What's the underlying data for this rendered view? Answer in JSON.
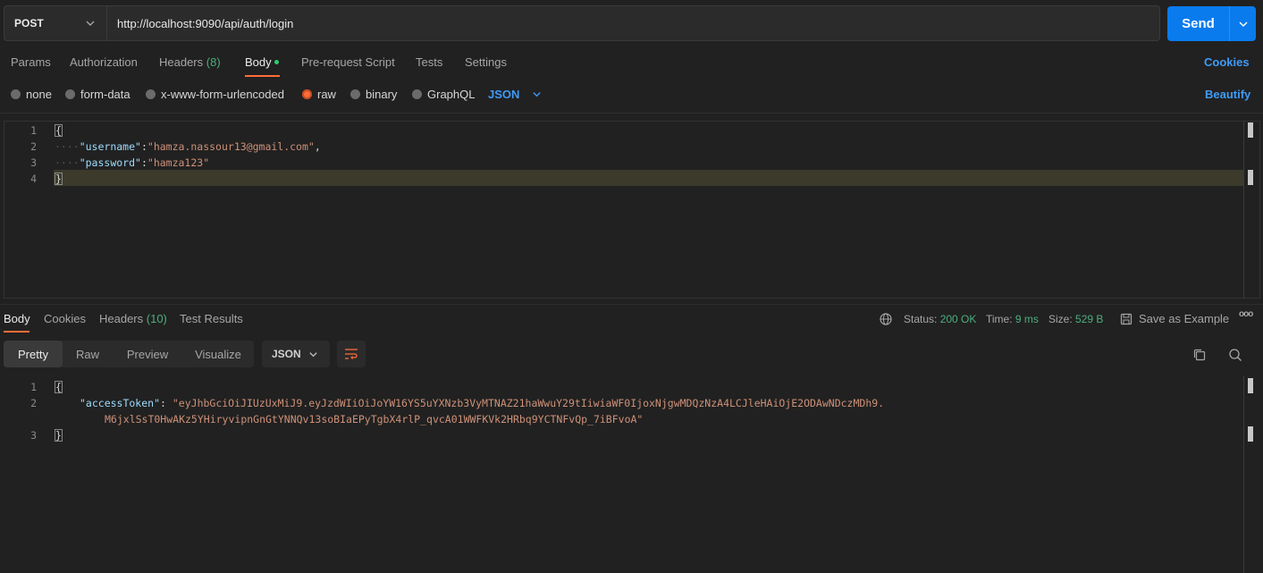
{
  "request": {
    "method": "POST",
    "url": "http://localhost:9090/api/auth/login",
    "send_label": "Send"
  },
  "request_tabs": {
    "params": "Params",
    "authorization": "Authorization",
    "headers": "Headers",
    "headers_count": "(8)",
    "body": "Body",
    "prerequest": "Pre-request Script",
    "tests": "Tests",
    "settings": "Settings",
    "cookies": "Cookies"
  },
  "body_types": {
    "none": "none",
    "form_data": "form-data",
    "urlencoded": "x-www-form-urlencoded",
    "raw": "raw",
    "binary": "binary",
    "graphql": "GraphQL",
    "format": "JSON",
    "beautify": "Beautify"
  },
  "request_body": {
    "line_numbers": [
      "1",
      "2",
      "3",
      "4"
    ],
    "open_brace": "{",
    "close_brace": "}",
    "username_key": "\"username\"",
    "username_value": "\"hamza.nassour13@gmail.com\"",
    "password_key": "\"password\"",
    "password_value": "\"hamza123\""
  },
  "response_tabs": {
    "body": "Body",
    "cookies": "Cookies",
    "headers": "Headers",
    "headers_count": "(10)",
    "test_results": "Test Results"
  },
  "response_meta": {
    "status_label": "Status:",
    "status_value": "200 OK",
    "time_label": "Time:",
    "time_value": "9 ms",
    "size_label": "Size:",
    "size_value": "529 B",
    "save_example": "Save as Example",
    "more": "ooo"
  },
  "response_view": {
    "pretty": "Pretty",
    "raw": "Raw",
    "preview": "Preview",
    "visualize": "Visualize",
    "format": "JSON"
  },
  "response_body": {
    "line_numbers": [
      "1",
      "2",
      "3"
    ],
    "open_brace": "{",
    "close_brace": "}",
    "token_key": "\"accessToken\"",
    "token_value_line1": "\"eyJhbGciOiJIUzUxMiJ9.eyJzdWIiOiJoYW16YS5uYXNzb3VyMTNAZ21haWwuY29tIiwiaWF0IjoxNjgwMDQzNzA4LCJleHAiOjE2ODAwNDczMDh9.",
    "token_value_line2": "M6jxlSsT0HwAKz5YHiryvipnGnGtYNNQv13soBIaEPyTgbX4rlP_qvcA01WWFKVk2HRbq9YCTNFvQp_7iBFvoA\""
  },
  "colors": {
    "accent_orange": "#ff6c37",
    "send_blue": "#097bed",
    "link_blue": "#3f9bf7",
    "status_green": "#4caf7d"
  }
}
